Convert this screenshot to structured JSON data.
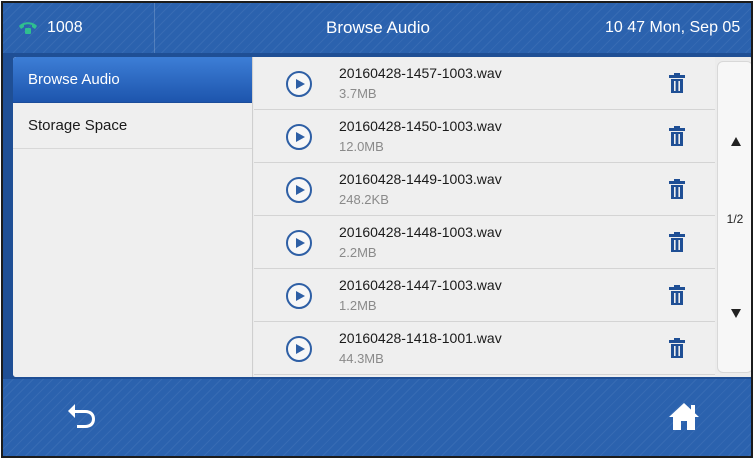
{
  "topbar": {
    "account": "1008",
    "title": "Browse Audio",
    "clock": "10 47 Mon, Sep 05"
  },
  "sidebar": {
    "items": [
      {
        "label": "Browse Audio",
        "active": true
      },
      {
        "label": "Storage Space",
        "active": false
      }
    ]
  },
  "files": [
    {
      "name": "20160428-1457-1003.wav",
      "size": "3.7MB"
    },
    {
      "name": "20160428-1450-1003.wav",
      "size": "12.0MB"
    },
    {
      "name": "20160428-1449-1003.wav",
      "size": "248.2KB"
    },
    {
      "name": "20160428-1448-1003.wav",
      "size": "2.2MB"
    },
    {
      "name": "20160428-1447-1003.wav",
      "size": "1.2MB"
    },
    {
      "name": "20160428-1418-1001.wav",
      "size": "44.3MB"
    }
  ],
  "pager": {
    "indicator": "1/2"
  },
  "icons": {
    "account": "phone-icon",
    "row_play": "play-icon",
    "row_delete": "trash-icon",
    "back": "back-arrow-icon",
    "home": "home-icon"
  },
  "colors": {
    "accent": "#2b62ae",
    "selected_item": "#2a69c4",
    "trash": "#1f4f95",
    "phone_icon": "#2fbf8f"
  }
}
